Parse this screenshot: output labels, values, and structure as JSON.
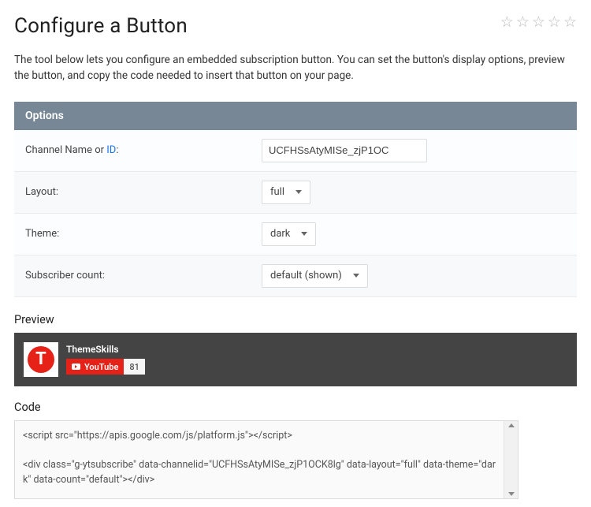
{
  "header": {
    "title": "Configure a Button",
    "star_count": 5
  },
  "intro": "The tool below lets you configure an embedded subscription button. You can set the button's display options, preview the button, and copy the code needed to insert that button on your page.",
  "options": {
    "header": "Options",
    "channel": {
      "label_prefix": "Channel Name or ",
      "id_link": "ID",
      "label_suffix": ":",
      "value": "UCFHSsAtyMISe_zjP1OC"
    },
    "layout": {
      "label": "Layout:",
      "value": "full"
    },
    "theme": {
      "label": "Theme:",
      "value": "dark"
    },
    "subcount": {
      "label": "Subscriber count:",
      "value": "default (shown)"
    }
  },
  "preview": {
    "title": "Preview",
    "channel_logo_letter": "T",
    "channel_name": "ThemeSkills",
    "button_text": "YouTube",
    "subscriber_count": "81"
  },
  "code": {
    "title": "Code",
    "content": "<script src=\"https://apis.google.com/js/platform.js\"></script>\n\n<div class=\"g-ytsubscribe\" data-channelid=\"UCFHSsAtyMISe_zjP1OCK8lg\" data-layout=\"full\" data-theme=\"dark\" data-count=\"default\"></div>"
  }
}
